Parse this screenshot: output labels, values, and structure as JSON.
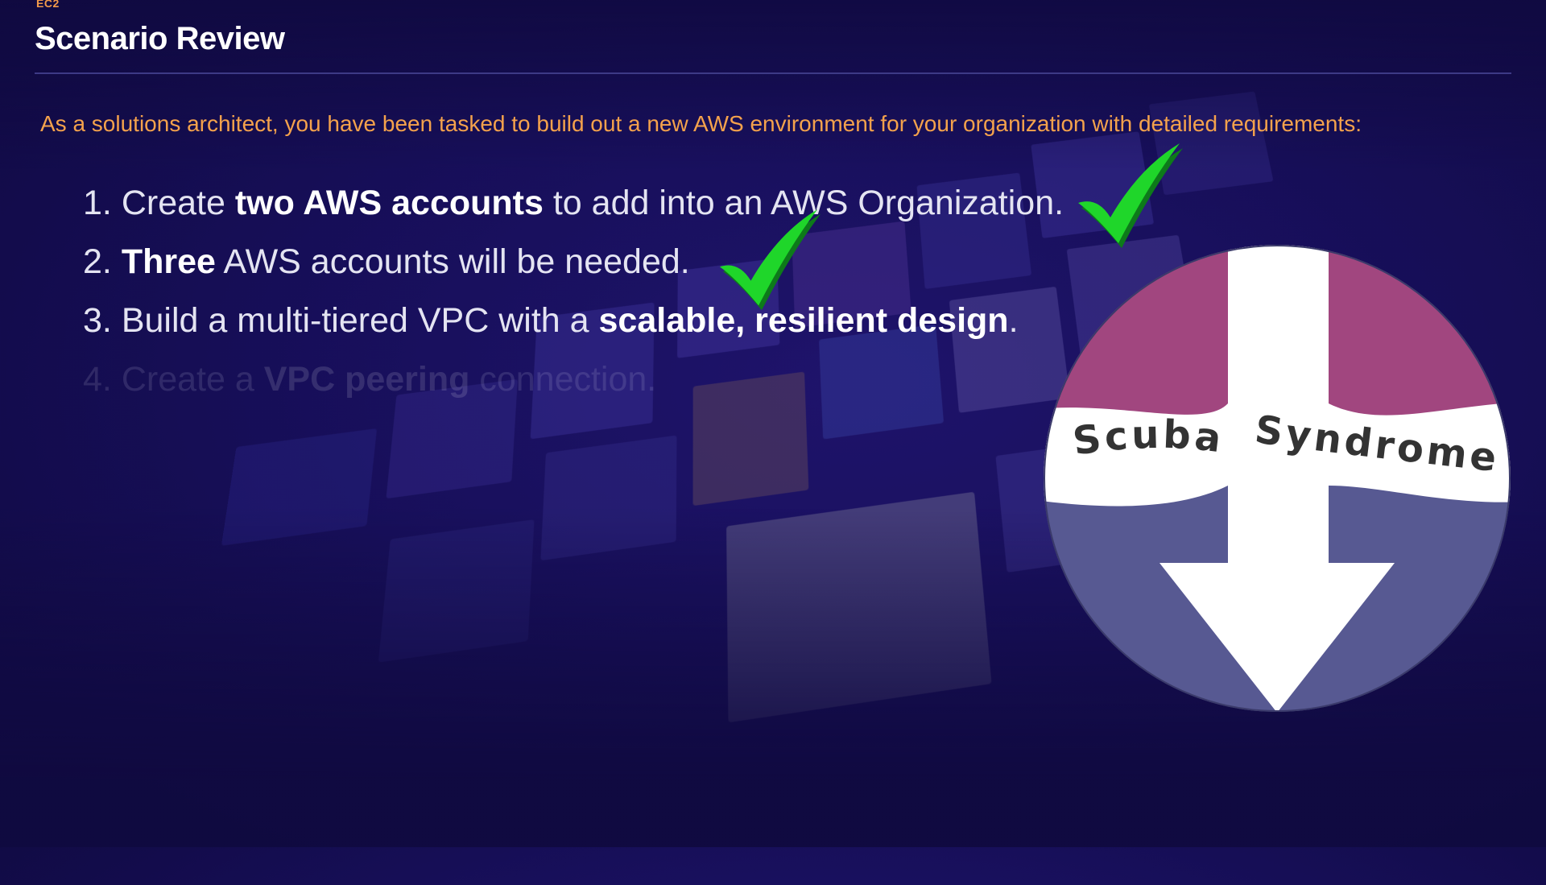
{
  "header": {
    "section_tag": "EC2",
    "title": "Scenario Review"
  },
  "intro": "As a solutions architect, you have been tasked to build out a new AWS environment for your organization with detailed requirements:",
  "requirements": [
    {
      "number": "1.",
      "pre": "Create ",
      "bold": "two AWS accounts",
      "post": " to add into an AWS Organization.",
      "checked": true
    },
    {
      "number": "2.",
      "pre": "",
      "bold": "Three",
      "post": " AWS accounts will be needed.",
      "checked": true
    },
    {
      "number": "3.",
      "pre": "Build a multi-tiered VPC with a ",
      "bold": "scalable, resilient design",
      "post": ".",
      "checked": false
    },
    {
      "number": "4.",
      "pre": "Create a ",
      "bold": "VPC peering",
      "post": " connection.",
      "checked": false
    }
  ],
  "logo": {
    "word_left": "Scuba",
    "word_right": "Syndrome",
    "top_color": "#a1467f",
    "bottom_color": "#575992",
    "arrow_color": "#ffffff"
  },
  "colors": {
    "accent_orange": "#f4a24c",
    "check_green": "#1fd62a",
    "background": "#1a1163"
  }
}
